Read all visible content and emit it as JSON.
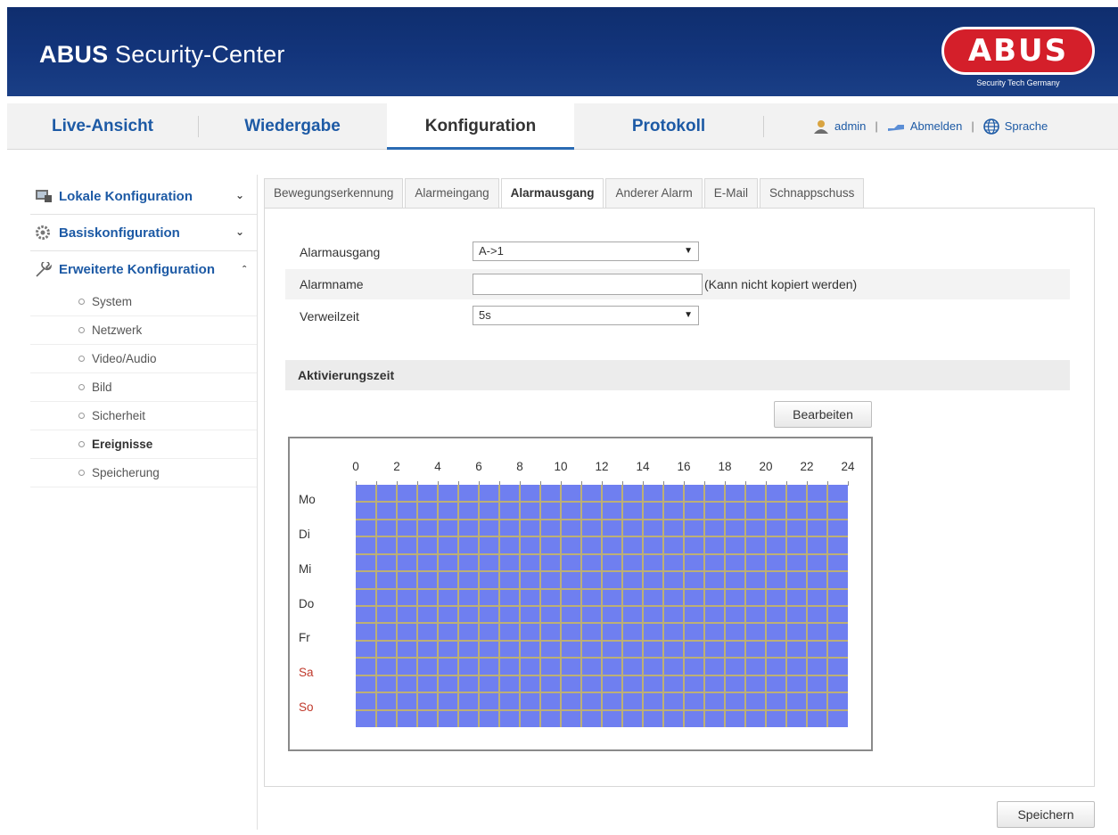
{
  "header": {
    "title_bold": "ABUS",
    "title_rest": " Security-Center",
    "logo_text": "ABUS",
    "logo_tagline": "Security Tech Germany"
  },
  "nav": {
    "items": [
      "Live-Ansicht",
      "Wiedergabe",
      "Konfiguration",
      "Protokoll"
    ],
    "active": "Konfiguration",
    "user": "admin",
    "logout": "Abmelden",
    "language": "Sprache"
  },
  "sidebar": {
    "sections": [
      {
        "label": "Lokale Konfiguration",
        "icon": "monitor-icon",
        "expanded": false
      },
      {
        "label": "Basiskonfiguration",
        "icon": "gear-icon",
        "expanded": false
      },
      {
        "label": "Erweiterte Konfiguration",
        "icon": "wrench-icon",
        "expanded": true
      }
    ],
    "subitems": [
      "System",
      "Netzwerk",
      "Video/Audio",
      "Bild",
      "Sicherheit",
      "Ereignisse",
      "Speicherung"
    ],
    "active_subitem": "Ereignisse"
  },
  "tabs": {
    "items": [
      "Bewegungserkennung",
      "Alarmeingang",
      "Alarmausgang",
      "Anderer Alarm",
      "E-Mail",
      "Schnappschuss"
    ],
    "active": "Alarmausgang"
  },
  "form": {
    "alarm_output_label": "Alarmausgang",
    "alarm_output_value": "A->1",
    "alarm_name_label": "Alarmname",
    "alarm_name_value": "",
    "alarm_name_hint": "(Kann nicht kopiert werden)",
    "dwell_label": "Verweilzeit",
    "dwell_value": "5s"
  },
  "schedule": {
    "section_title": "Aktivierungszeit",
    "edit_button": "Bearbeiten",
    "hours": [
      "0",
      "2",
      "4",
      "6",
      "8",
      "10",
      "12",
      "14",
      "16",
      "18",
      "20",
      "22",
      "24"
    ],
    "days": [
      "Mo",
      "Di",
      "Mi",
      "Do",
      "Fr",
      "Sa",
      "So"
    ],
    "weekend_days": [
      "Sa",
      "So"
    ],
    "active_color": "#6f7ff0",
    "weekend_color": "#c0392b"
  },
  "footer": {
    "save_button": "Speichern"
  }
}
